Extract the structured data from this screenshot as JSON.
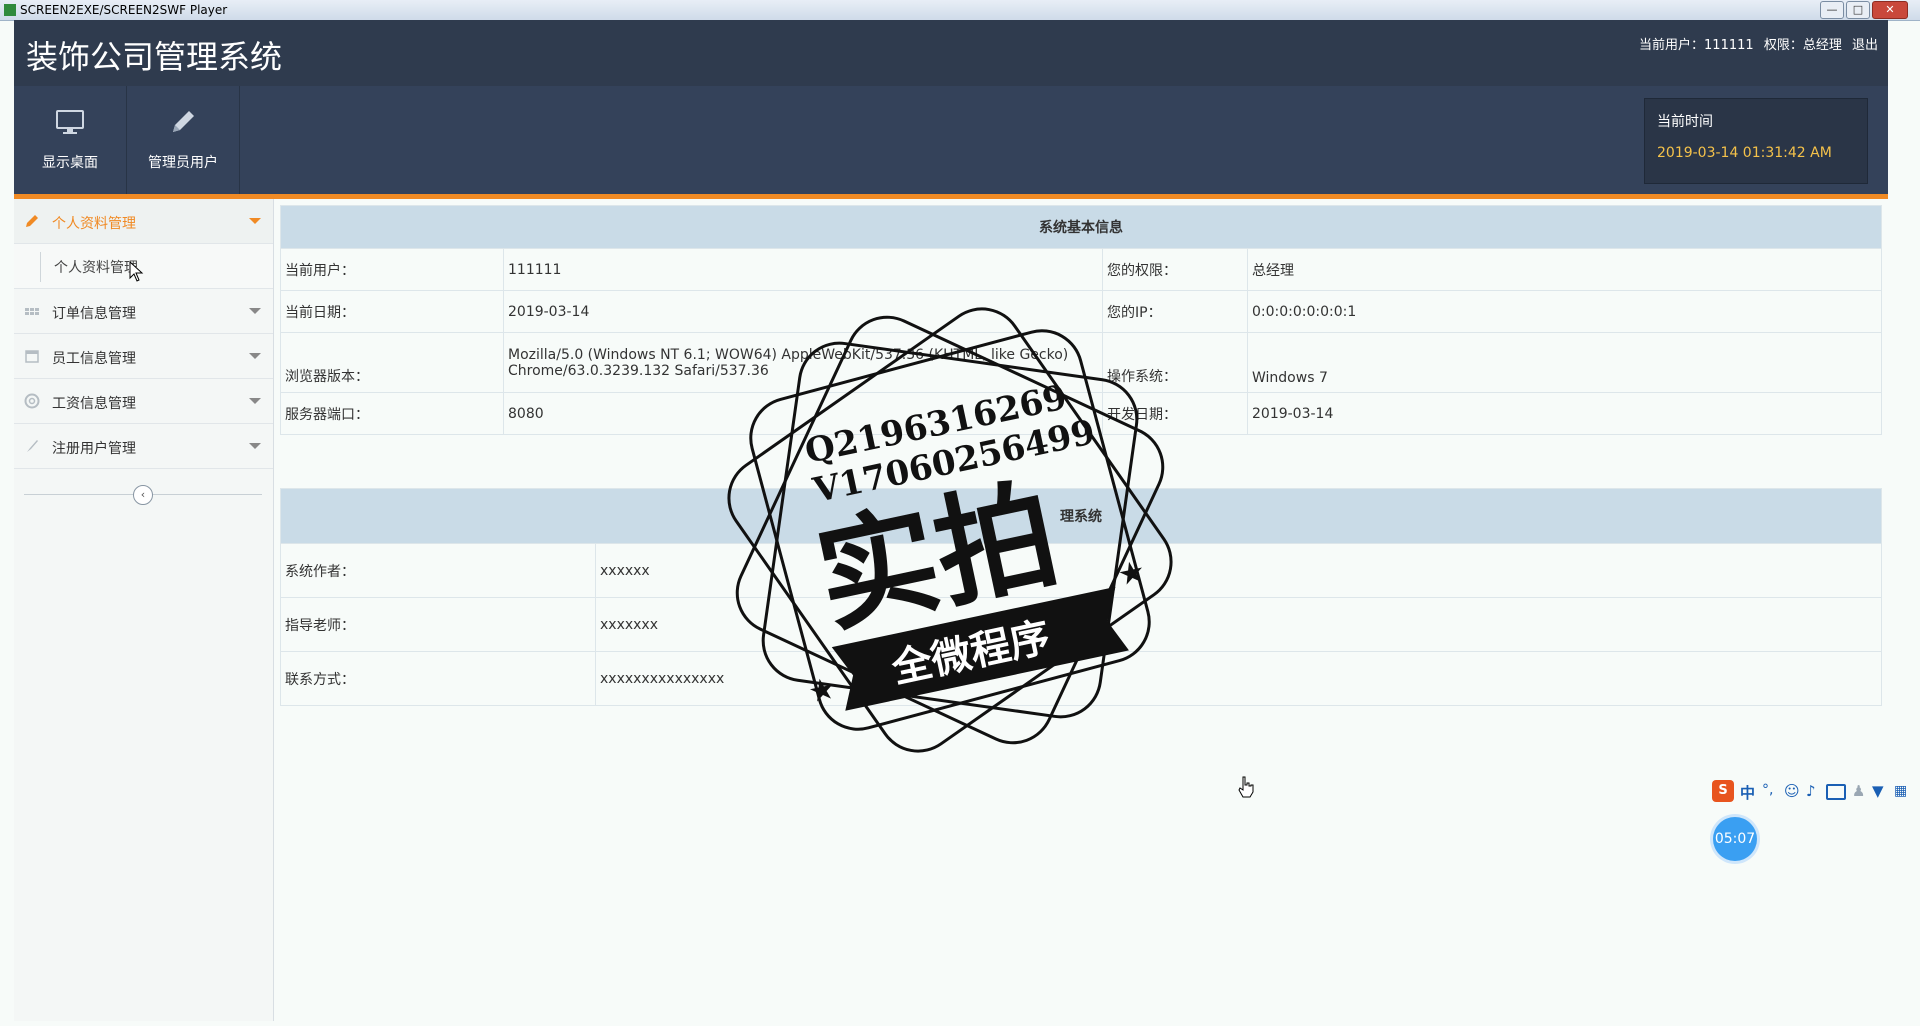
{
  "player": {
    "title": "SCREEN2EXE/SCREEN2SWF Player",
    "minimize": "—",
    "maximize": "□",
    "close": "✕"
  },
  "header": {
    "app_title": "装饰公司管理系统",
    "current_user_label": "当前用户：",
    "current_user": "111111",
    "role_label": "权限：",
    "role": "总经理",
    "logout": "退出"
  },
  "toolbar": {
    "buttons": [
      {
        "label": "显示桌面",
        "icon": "monitor-icon"
      },
      {
        "label": "管理员用户",
        "icon": "pencil-icon"
      }
    ],
    "time_caption": "当前时间",
    "time_value": "2019-03-14 01:31:42 AM"
  },
  "sidebar": {
    "items": [
      {
        "label": "个人资料管理",
        "icon": "pencil-icon",
        "active": true
      },
      {
        "label": "订单信息管理",
        "icon": "grid-icon"
      },
      {
        "label": "员工信息管理",
        "icon": "calendar-icon"
      },
      {
        "label": "工资信息管理",
        "icon": "lifebuoy-icon"
      },
      {
        "label": "注册用户管理",
        "icon": "brush-icon"
      }
    ],
    "sub_items": [
      {
        "label": "个人资料管理"
      }
    ],
    "collapse_icon": "chevron-left-icon"
  },
  "system_info": {
    "heading": "系统基本信息",
    "rows": [
      {
        "k1": "当前用户：",
        "v1": "111111",
        "k2": "您的权限：",
        "v2": "总经理"
      },
      {
        "k1": "当前日期：",
        "v1": "2019-03-14",
        "k2": "您的IP：",
        "v2": "0:0:0:0:0:0:0:1"
      },
      {
        "k1": "浏览器版本：",
        "v1a": "Mozilla/5.0 (Windows NT 6.1; WOW64) AppleWebKit/537.36 (KHTML, like Gecko)",
        "v1b": "Chrome/63.0.3239.132 Safari/537.36",
        "k2": "操作系统：",
        "v2": "Windows 7"
      },
      {
        "k1": "服务器端口：",
        "v1": "8080",
        "k2": "开发日期：",
        "v2": "2019-03-14"
      }
    ]
  },
  "system_dev": {
    "heading": "理系统",
    "rows": [
      {
        "k": "系统作者：",
        "v": "xxxxxx"
      },
      {
        "k": "指导老师：",
        "v": "xxxxxxx"
      },
      {
        "k": "联系方式：",
        "v": "xxxxxxxxxxxxxxx"
      }
    ]
  },
  "watermark": {
    "line1": "Q2196316269",
    "line2": "V17060256499",
    "big": "实拍",
    "banner": "全微程序"
  },
  "overlay": {
    "ime_label": "中",
    "timer": "05:07"
  },
  "colors": {
    "header": "#2f3b4e",
    "toolbar": "#34425a",
    "accent": "#f08a24",
    "time_value": "#f5c24a",
    "table_head": "#c9dbe7"
  }
}
